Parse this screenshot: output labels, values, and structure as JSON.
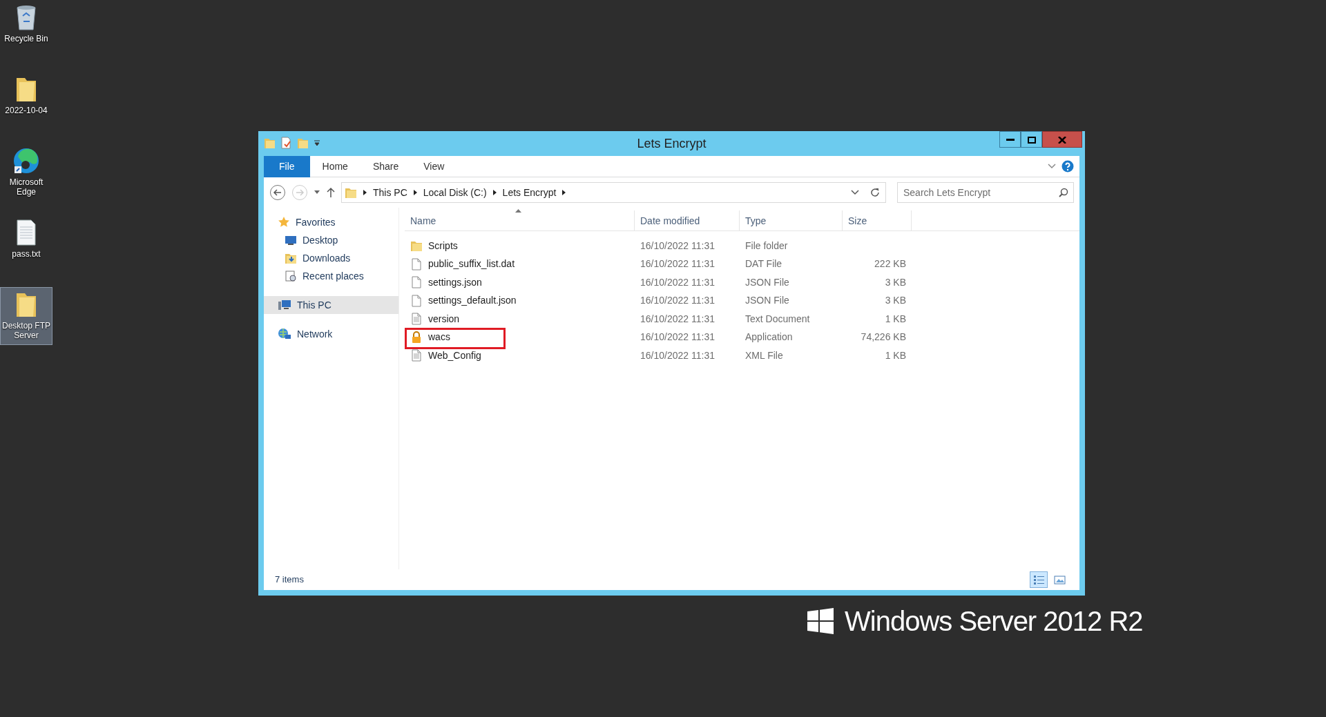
{
  "desktop_icons": [
    {
      "label": "Recycle Bin",
      "kind": "recycle",
      "selected": false
    },
    {
      "label": "2022-10-04",
      "kind": "folder",
      "selected": false
    },
    {
      "label": "Microsoft Edge",
      "kind": "edge",
      "selected": false
    },
    {
      "label": "pass.txt",
      "kind": "text",
      "selected": false
    },
    {
      "label": "Desktop FTP Server",
      "kind": "folder",
      "selected": true
    }
  ],
  "window": {
    "title": "Lets Encrypt",
    "ribbon_tabs": [
      {
        "label": "File",
        "kind": "file"
      },
      {
        "label": "Home",
        "kind": "tab"
      },
      {
        "label": "Share",
        "kind": "tab"
      },
      {
        "label": "View",
        "kind": "tab"
      }
    ],
    "breadcrumb": [
      "This PC",
      "Local Disk (C:)",
      "Lets Encrypt"
    ],
    "search": {
      "placeholder": "Search Lets Encrypt"
    },
    "nav": [
      {
        "label": "Favorites",
        "kind": "star",
        "selected": false,
        "children": [
          {
            "label": "Desktop",
            "kind": "desktop",
            "selected": false
          },
          {
            "label": "Downloads",
            "kind": "downloads",
            "selected": false
          },
          {
            "label": "Recent places",
            "kind": "recent",
            "selected": false
          }
        ]
      },
      {
        "label": "This PC",
        "kind": "pc",
        "selected": true
      },
      {
        "label": "Network",
        "kind": "network",
        "selected": false
      }
    ],
    "columns": [
      "Name",
      "Date modified",
      "Type",
      "Size"
    ],
    "files": [
      {
        "name": "Scripts",
        "date": "16/10/2022 11:31",
        "type": "File folder",
        "kind": "folder",
        "highlighted": false
      },
      {
        "name": "public_suffix_list.dat",
        "date": "16/10/2022 11:31",
        "type": "DAT File",
        "size": "222 KB",
        "kind": "file",
        "highlighted": false
      },
      {
        "name": "settings.json",
        "date": "16/10/2022 11:31",
        "type": "JSON File",
        "size": "3 KB",
        "kind": "file",
        "highlighted": false
      },
      {
        "name": "settings_default.json",
        "date": "16/10/2022 11:31",
        "type": "JSON File",
        "size": "3 KB",
        "kind": "file",
        "highlighted": false
      },
      {
        "name": "version",
        "date": "16/10/2022 11:31",
        "type": "Text Document",
        "size": "1 KB",
        "kind": "text",
        "highlighted": false
      },
      {
        "name": "wacs",
        "date": "16/10/2022 11:31",
        "type": "Application",
        "size": "74,226 KB",
        "kind": "lock",
        "highlighted": true
      },
      {
        "name": "Web_Config",
        "date": "16/10/2022 11:31",
        "type": "XML File",
        "size": "1 KB",
        "kind": "text",
        "highlighted": false
      }
    ],
    "status": "7 items",
    "views": [
      {
        "kind": "details",
        "selected": true
      },
      {
        "kind": "tiles",
        "selected": false
      }
    ]
  },
  "branding": "Windows Server 2012 R2"
}
